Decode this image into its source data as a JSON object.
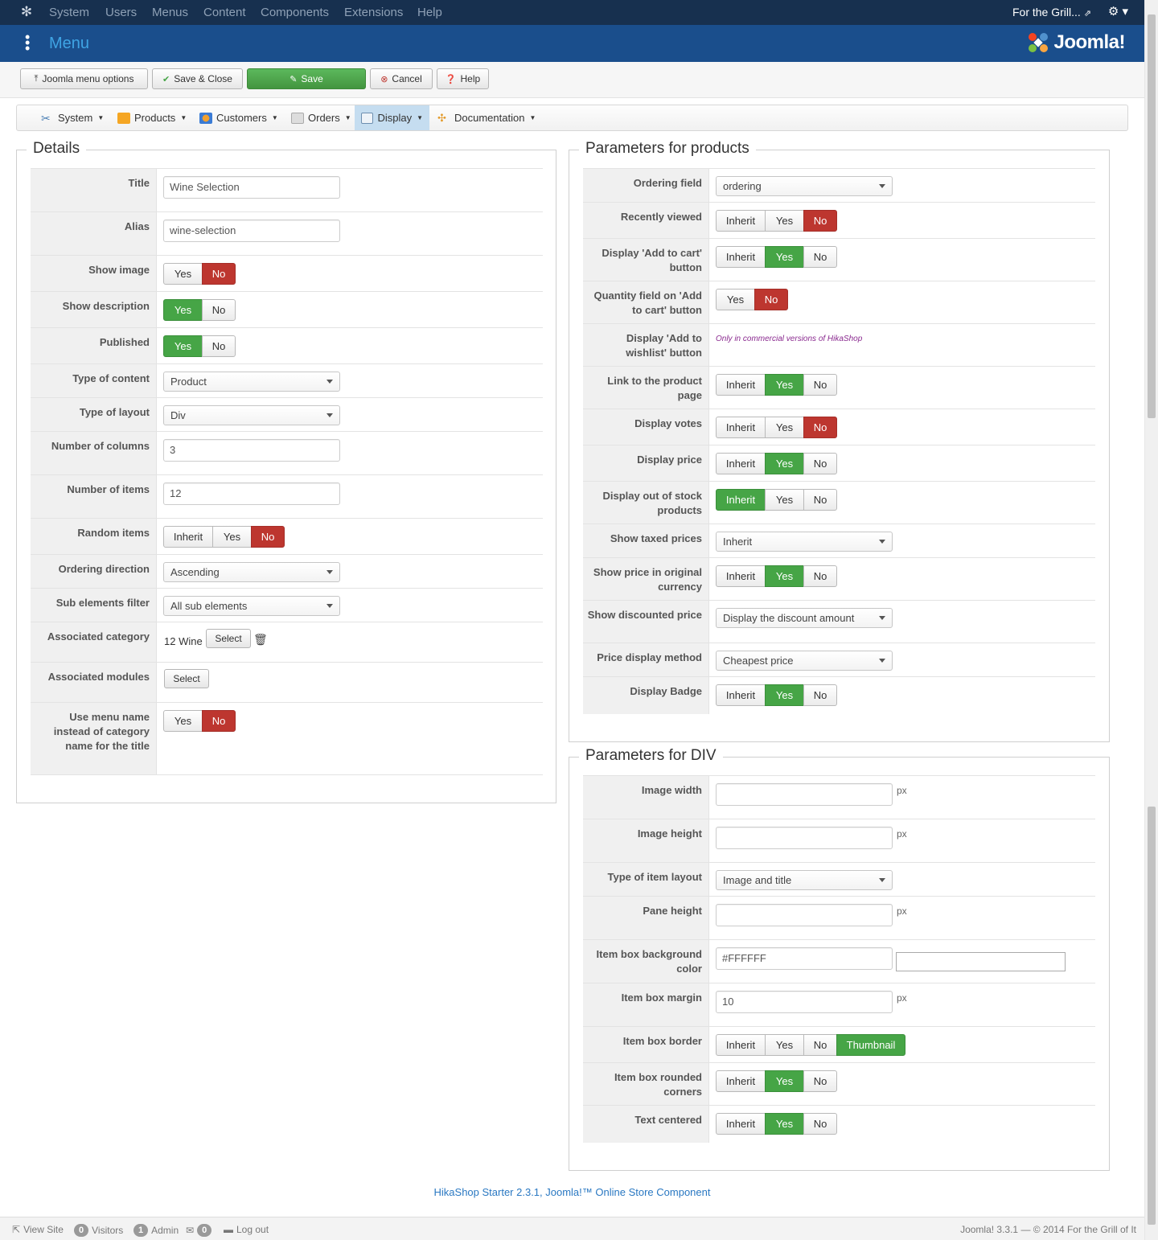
{
  "topbar": {
    "menu": [
      "System",
      "Users",
      "Menus",
      "Content",
      "Components",
      "Extensions",
      "Help"
    ],
    "site_name": "For the Grill..."
  },
  "header": {
    "title": "Menu",
    "brand": "Joomla!"
  },
  "toolbar": {
    "joomla_menu_options": "Joomla menu options",
    "save_close": "Save & Close",
    "save": "Save",
    "cancel": "Cancel",
    "help": "Help"
  },
  "hikamenu": {
    "items": [
      "System",
      "Products",
      "Customers",
      "Orders",
      "Display",
      "Documentation"
    ],
    "active": "Display"
  },
  "details": {
    "legend": "Details",
    "title_label": "Title",
    "title_value": "Wine Selection",
    "alias_label": "Alias",
    "alias_value": "wine-selection",
    "show_image_label": "Show image",
    "show_description_label": "Show description",
    "published_label": "Published",
    "type_content_label": "Type of content",
    "type_content_value": "Product",
    "type_layout_label": "Type of layout",
    "type_layout_value": "Div",
    "columns_label": "Number of columns",
    "columns_value": "3",
    "items_label": "Number of items",
    "items_value": "12",
    "random_label": "Random items",
    "ordering_dir_label": "Ordering direction",
    "ordering_dir_value": "Ascending",
    "sub_filter_label": "Sub elements filter",
    "sub_filter_value": "All sub elements",
    "assoc_cat_label": "Associated category",
    "assoc_cat_value": "12 Wine",
    "select_label": "Select",
    "assoc_mod_label": "Associated modules",
    "use_menu_name_label": "Use menu name instead of category name for the title"
  },
  "toggles": {
    "inherit": "Inherit",
    "yes": "Yes",
    "no": "No",
    "thumbnail": "Thumbnail"
  },
  "products": {
    "legend": "Parameters for products",
    "ordering_field_label": "Ordering field",
    "ordering_field_value": "ordering",
    "recently_viewed_label": "Recently viewed",
    "add_to_cart_label": "Display 'Add to cart' button",
    "qty_field_label": "Quantity field on 'Add to cart' button",
    "wishlist_label": "Display 'Add to wishlist' button",
    "wishlist_note": "Only in commercial versions of HikaShop",
    "link_product_label": "Link to the product page",
    "votes_label": "Display votes",
    "price_label": "Display price",
    "out_of_stock_label": "Display out of stock products",
    "taxed_label": "Show taxed prices",
    "taxed_value": "Inherit",
    "orig_currency_label": "Show price in original currency",
    "discounted_label": "Show discounted price",
    "discounted_value": "Display the discount amount",
    "price_method_label": "Price display method",
    "price_method_value": "Cheapest price",
    "badge_label": "Display Badge"
  },
  "div": {
    "legend": "Parameters for DIV",
    "img_w_label": "Image width",
    "img_h_label": "Image height",
    "item_layout_label": "Type of item layout",
    "item_layout_value": "Image and title",
    "pane_h_label": "Pane height",
    "bg_color_label": "Item box background color",
    "bg_color_value": "#FFFFFF",
    "margin_label": "Item box margin",
    "margin_value": "10",
    "border_label": "Item box border",
    "rounded_label": "Item box rounded corners",
    "centered_label": "Text centered",
    "px": "px"
  },
  "footer": {
    "credit": "HikaShop Starter 2.3.1, Joomla!™ Online Store Component"
  },
  "statusbar": {
    "view_site": "View Site",
    "visitors_count": "0",
    "visitors": "Visitors",
    "admin_count": "1",
    "admin": "Admin",
    "mail_count": "0",
    "logout": "Log out",
    "copyright": "Joomla! 3.3.1 — © 2014 For the Grill of It"
  },
  "colors": {
    "navbar": "#17304f",
    "header": "#1a4e8c",
    "green": "#46a546",
    "red": "#bd362f",
    "link": "#2a78c2"
  }
}
